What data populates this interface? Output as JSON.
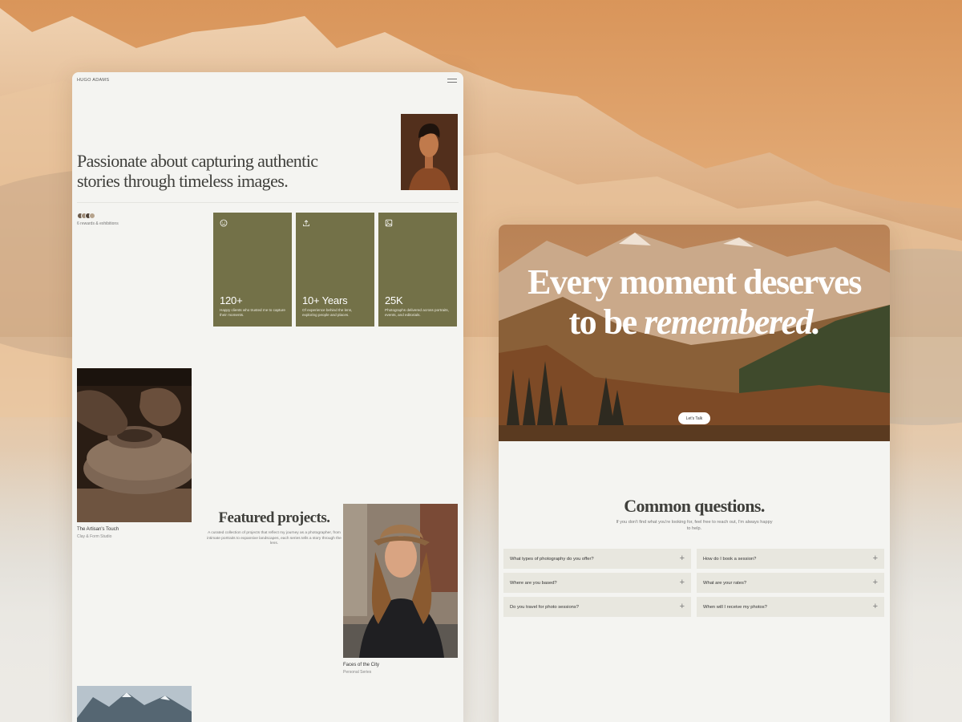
{
  "site": {
    "brand": "HUGO ADAMS"
  },
  "hero": {
    "title": "Passionate about capturing authentic stories through timeless images."
  },
  "credentials": {
    "rewards_text": "6 rewards & exhibitions"
  },
  "stats": [
    {
      "icon": "smile-icon",
      "number": "120+",
      "description": "Happy clients who trusted me to capture their moments."
    },
    {
      "icon": "upload-icon",
      "number": "10+ Years",
      "description": "Of experience behind the lens, exploring people and places."
    },
    {
      "icon": "image-icon",
      "number": "25K",
      "description": "Photographs delivered across portraits, events, and editorials."
    }
  ],
  "featured": {
    "heading": "Featured projects.",
    "description": "A curated collection of projects that reflect my journey as a photographer, from intimate portraits to expansive landscapes, each series tells a story through the lens.",
    "projects": [
      {
        "title": "The Artisan's Touch",
        "subtitle": "Clay & Form Studio"
      },
      {
        "title": "Faces of the City",
        "subtitle": "Personal Series"
      }
    ]
  },
  "hero2": {
    "title_line1": "Every moment deserves",
    "title_line2_plain": "to be ",
    "title_line2_italic": "remembered.",
    "cta_label": "Let's Talk"
  },
  "faq": {
    "heading": "Common questions.",
    "subtitle": "If you don't find what you're looking for, feel free to reach out, I'm always happy to help.",
    "questions": [
      "What types of photography do you offer?",
      "How do I book a session?",
      "Where are you based?",
      "What are your rates?",
      "Do you travel for photo sessions?",
      "When will I receive my photos?"
    ],
    "expand_symbol": "+"
  },
  "colors": {
    "accent": "#737148",
    "panel_bg": "#f4f4f1",
    "faq_item_bg": "#e8e7df",
    "backdrop": "#e3ad7a"
  }
}
